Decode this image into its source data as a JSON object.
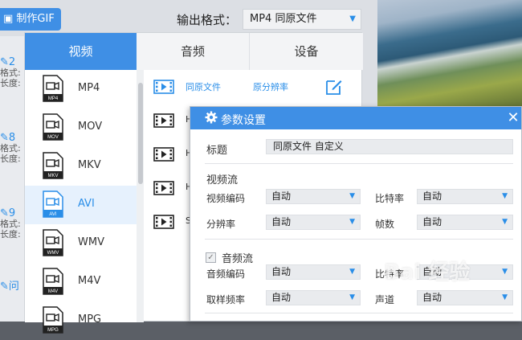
{
  "toolbar": {
    "gif_button": "制作GIF",
    "format_label": "输出格式：",
    "format_value": "MP4  同原文件"
  },
  "left_strip": {
    "items": [
      {
        "num": "2",
        "line1": "格式:",
        "line2": "长度:"
      },
      {
        "num": "8",
        "line1": "格式:",
        "line2": "长度:"
      },
      {
        "num": "9",
        "line1": "格式:",
        "line2": "长度:"
      },
      {
        "num": "问",
        "line1": "",
        "line2": ""
      }
    ]
  },
  "format_panel": {
    "tabs": [
      "视频",
      "音频",
      "设备"
    ],
    "formats": [
      {
        "name": "MP4",
        "tag": "MP4"
      },
      {
        "name": "MOV",
        "tag": "MOV"
      },
      {
        "name": "MKV",
        "tag": "MKV"
      },
      {
        "name": "AVI",
        "tag": "AVI"
      },
      {
        "name": "WMV",
        "tag": "WMV"
      },
      {
        "name": "M4V",
        "tag": "M4V"
      },
      {
        "name": "MPG",
        "tag": "MPG"
      }
    ],
    "selected_format": "AVI",
    "resolutions": [
      {
        "name": "同原文件",
        "value": "原分辨率"
      },
      {
        "name": "H",
        "value": ""
      },
      {
        "name": "H",
        "value": ""
      },
      {
        "name": "H",
        "value": ""
      },
      {
        "name": "S",
        "value": ""
      }
    ]
  },
  "settings": {
    "title": "参数设置",
    "close": "✕",
    "title_label": "标题",
    "title_value": "同原文件 自定义",
    "video_stream": "视频流",
    "video_codec_label": "视频编码",
    "video_codec_value": "自动",
    "video_bitrate_label": "比特率",
    "video_bitrate_value": "自动",
    "resolution_label": "分辨率",
    "resolution_value": "自动",
    "fps_label": "帧数",
    "fps_value": "自动",
    "audio_stream": "音频流",
    "audio_checked": true,
    "audio_codec_label": "音频编码",
    "audio_codec_value": "自动",
    "audio_bitrate_label": "比特率",
    "audio_bitrate_value": "自动",
    "sample_rate_label": "取样频率",
    "sample_rate_value": "自动",
    "channel_label": "声道",
    "channel_value": "自动"
  },
  "watermark": "Bai 经验",
  "colors": {
    "accent": "#3f8fe5",
    "selected_bg": "#e6f1fd"
  }
}
